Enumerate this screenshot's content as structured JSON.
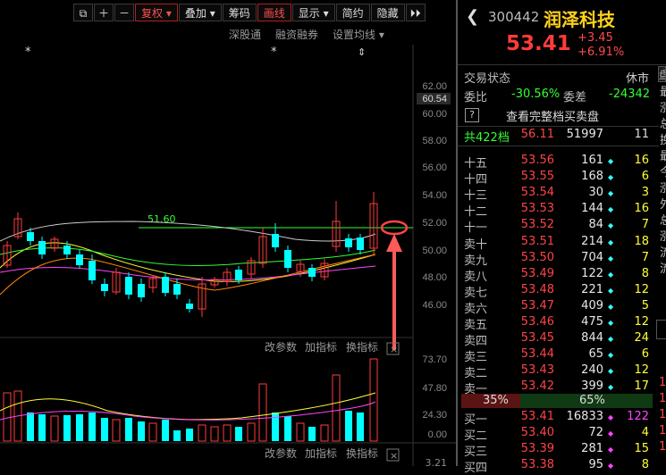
{
  "toolbar": {
    "buttons": [
      "复权",
      "叠加",
      "筹码",
      "画线",
      "显示",
      "简约",
      "隐藏"
    ],
    "active": [
      "复权",
      "画线"
    ]
  },
  "sublinks": [
    "深股通",
    "融资融券",
    "设置均线"
  ],
  "stock": {
    "code": "300442",
    "name": "润泽科技",
    "price": "53.41",
    "change": "+3.45",
    "pct": "+6.91%"
  },
  "status": {
    "label": "交易状态",
    "value": "休市",
    "tab": "盘"
  },
  "ratio": {
    "label1": "委比",
    "val1": "-30.56%",
    "label2": "委差",
    "val2": "-24342"
  },
  "full_book": {
    "icon_label": "?",
    "text": "查看完整档买卖盘"
  },
  "total_levels": {
    "label": "共422档",
    "price": "56.11",
    "vol": "51997",
    "chg": "11"
  },
  "asks": [
    {
      "label": "十五",
      "price": "53.56",
      "vol": "161",
      "chg": "16"
    },
    {
      "label": "十四",
      "price": "53.55",
      "vol": "168",
      "chg": "6"
    },
    {
      "label": "十三",
      "price": "53.54",
      "vol": "30",
      "chg": "3"
    },
    {
      "label": "十二",
      "price": "53.53",
      "vol": "144",
      "chg": "16"
    },
    {
      "label": "十一",
      "price": "53.52",
      "vol": "84",
      "chg": "7"
    },
    {
      "label": "卖十",
      "price": "53.51",
      "vol": "214",
      "chg": "18"
    },
    {
      "label": "卖九",
      "price": "53.50",
      "vol": "704",
      "chg": "7"
    },
    {
      "label": "卖八",
      "price": "53.49",
      "vol": "122",
      "chg": "8"
    },
    {
      "label": "卖七",
      "price": "53.48",
      "vol": "221",
      "chg": "12"
    },
    {
      "label": "卖六",
      "price": "53.47",
      "vol": "409",
      "chg": "5"
    },
    {
      "label": "卖五",
      "price": "53.46",
      "vol": "475",
      "chg": "12"
    },
    {
      "label": "卖四",
      "price": "53.45",
      "vol": "844",
      "chg": "24"
    },
    {
      "label": "卖三",
      "price": "53.44",
      "vol": "65",
      "chg": "6"
    },
    {
      "label": "卖二",
      "price": "53.43",
      "vol": "240",
      "chg": "12"
    },
    {
      "label": "卖一",
      "price": "53.42",
      "vol": "399",
      "chg": "17"
    }
  ],
  "split": {
    "sell": "35%",
    "buy": "65%"
  },
  "bids": [
    {
      "label": "买一",
      "price": "53.41",
      "vol": "16833",
      "chg": "122"
    },
    {
      "label": "买二",
      "price": "53.40",
      "vol": "72",
      "chg": "4"
    },
    {
      "label": "买三",
      "price": "53.39",
      "vol": "281",
      "chg": "15"
    },
    {
      "label": "买四",
      "price": "53.38",
      "vol": "95",
      "chg": "8"
    }
  ],
  "right_edge_text": [
    "最",
    "涨",
    "总",
    "换",
    "最",
    "今",
    "涨",
    "外",
    "总",
    "涨",
    "流",
    "流"
  ],
  "main_chart": {
    "y_ticks": [
      "62.00",
      "60.54",
      "60.00",
      "58.00",
      "56.00",
      "54.00",
      "52.00",
      "50.00",
      "48.00",
      "46.00"
    ],
    "line_label": "51.60",
    "markers": [
      "*",
      "*",
      "⇕"
    ]
  },
  "indicator": {
    "buttons": [
      "改参数",
      "加指标",
      "换指标"
    ]
  },
  "volume": {
    "y_ticks": [
      "73.70",
      "47.80",
      "24.30",
      "0.00"
    ]
  },
  "bottom": {
    "buttons": [
      "改参数",
      "加指标",
      "换指标"
    ],
    "tick": "3.21"
  },
  "colors": {
    "up": "#ff3b3b",
    "down": "#00ffff",
    "green": "#33ff33",
    "bg": "#000000"
  }
}
